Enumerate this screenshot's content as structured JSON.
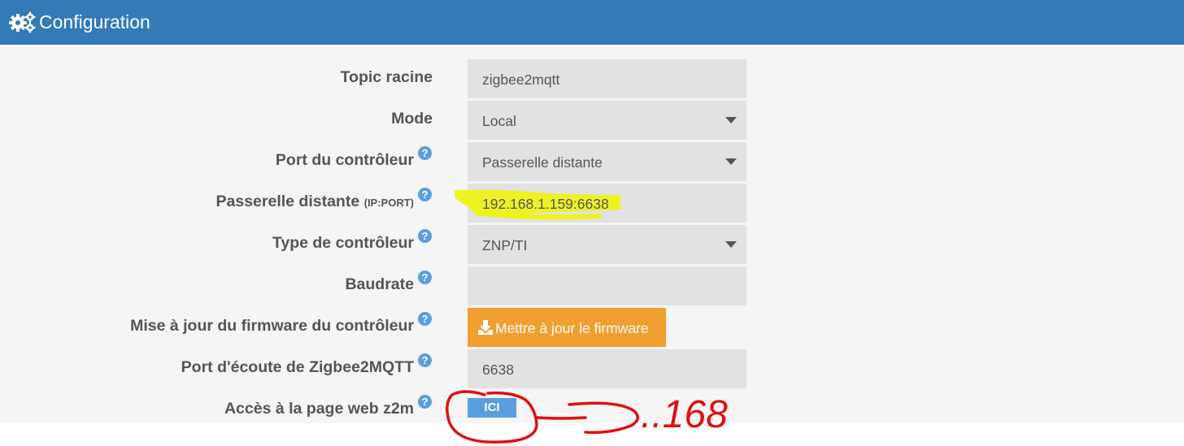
{
  "header": {
    "title": "Configuration",
    "icon": "gears-icon"
  },
  "form": {
    "rows": [
      {
        "label": "Topic racine",
        "value": "zigbee2mqtt"
      },
      {
        "label": "Mode",
        "value": "Local"
      },
      {
        "label": "Port du contrôleur",
        "value": "Passerelle distante"
      },
      {
        "label": "Passerelle distante",
        "label_suffix": "(IP:PORT)",
        "value": "192.168.1.159:6638"
      },
      {
        "label": "Type de contrôleur",
        "value": "ZNP/TI"
      },
      {
        "label": "Baudrate",
        "value": ""
      },
      {
        "label": "Mise à jour du firmware du contrôleur",
        "button": "Mettre à jour le firmware"
      },
      {
        "label": "Port d'écoute de Zigbee2MQTT",
        "value": "6638"
      },
      {
        "label": "Accès à la page web z2m",
        "button": "ICI"
      }
    ],
    "help_glyph": "?"
  },
  "annotation": {
    "text": "..168"
  },
  "colors": {
    "header_bg": "#337ab7",
    "panel_bg": "#f5f5f5",
    "field_bg": "#e2e2e2",
    "orange_button": "#f0a030",
    "blue_button": "#5a9ee0",
    "highlight": "#eef21a",
    "annotation": "#e01010"
  }
}
